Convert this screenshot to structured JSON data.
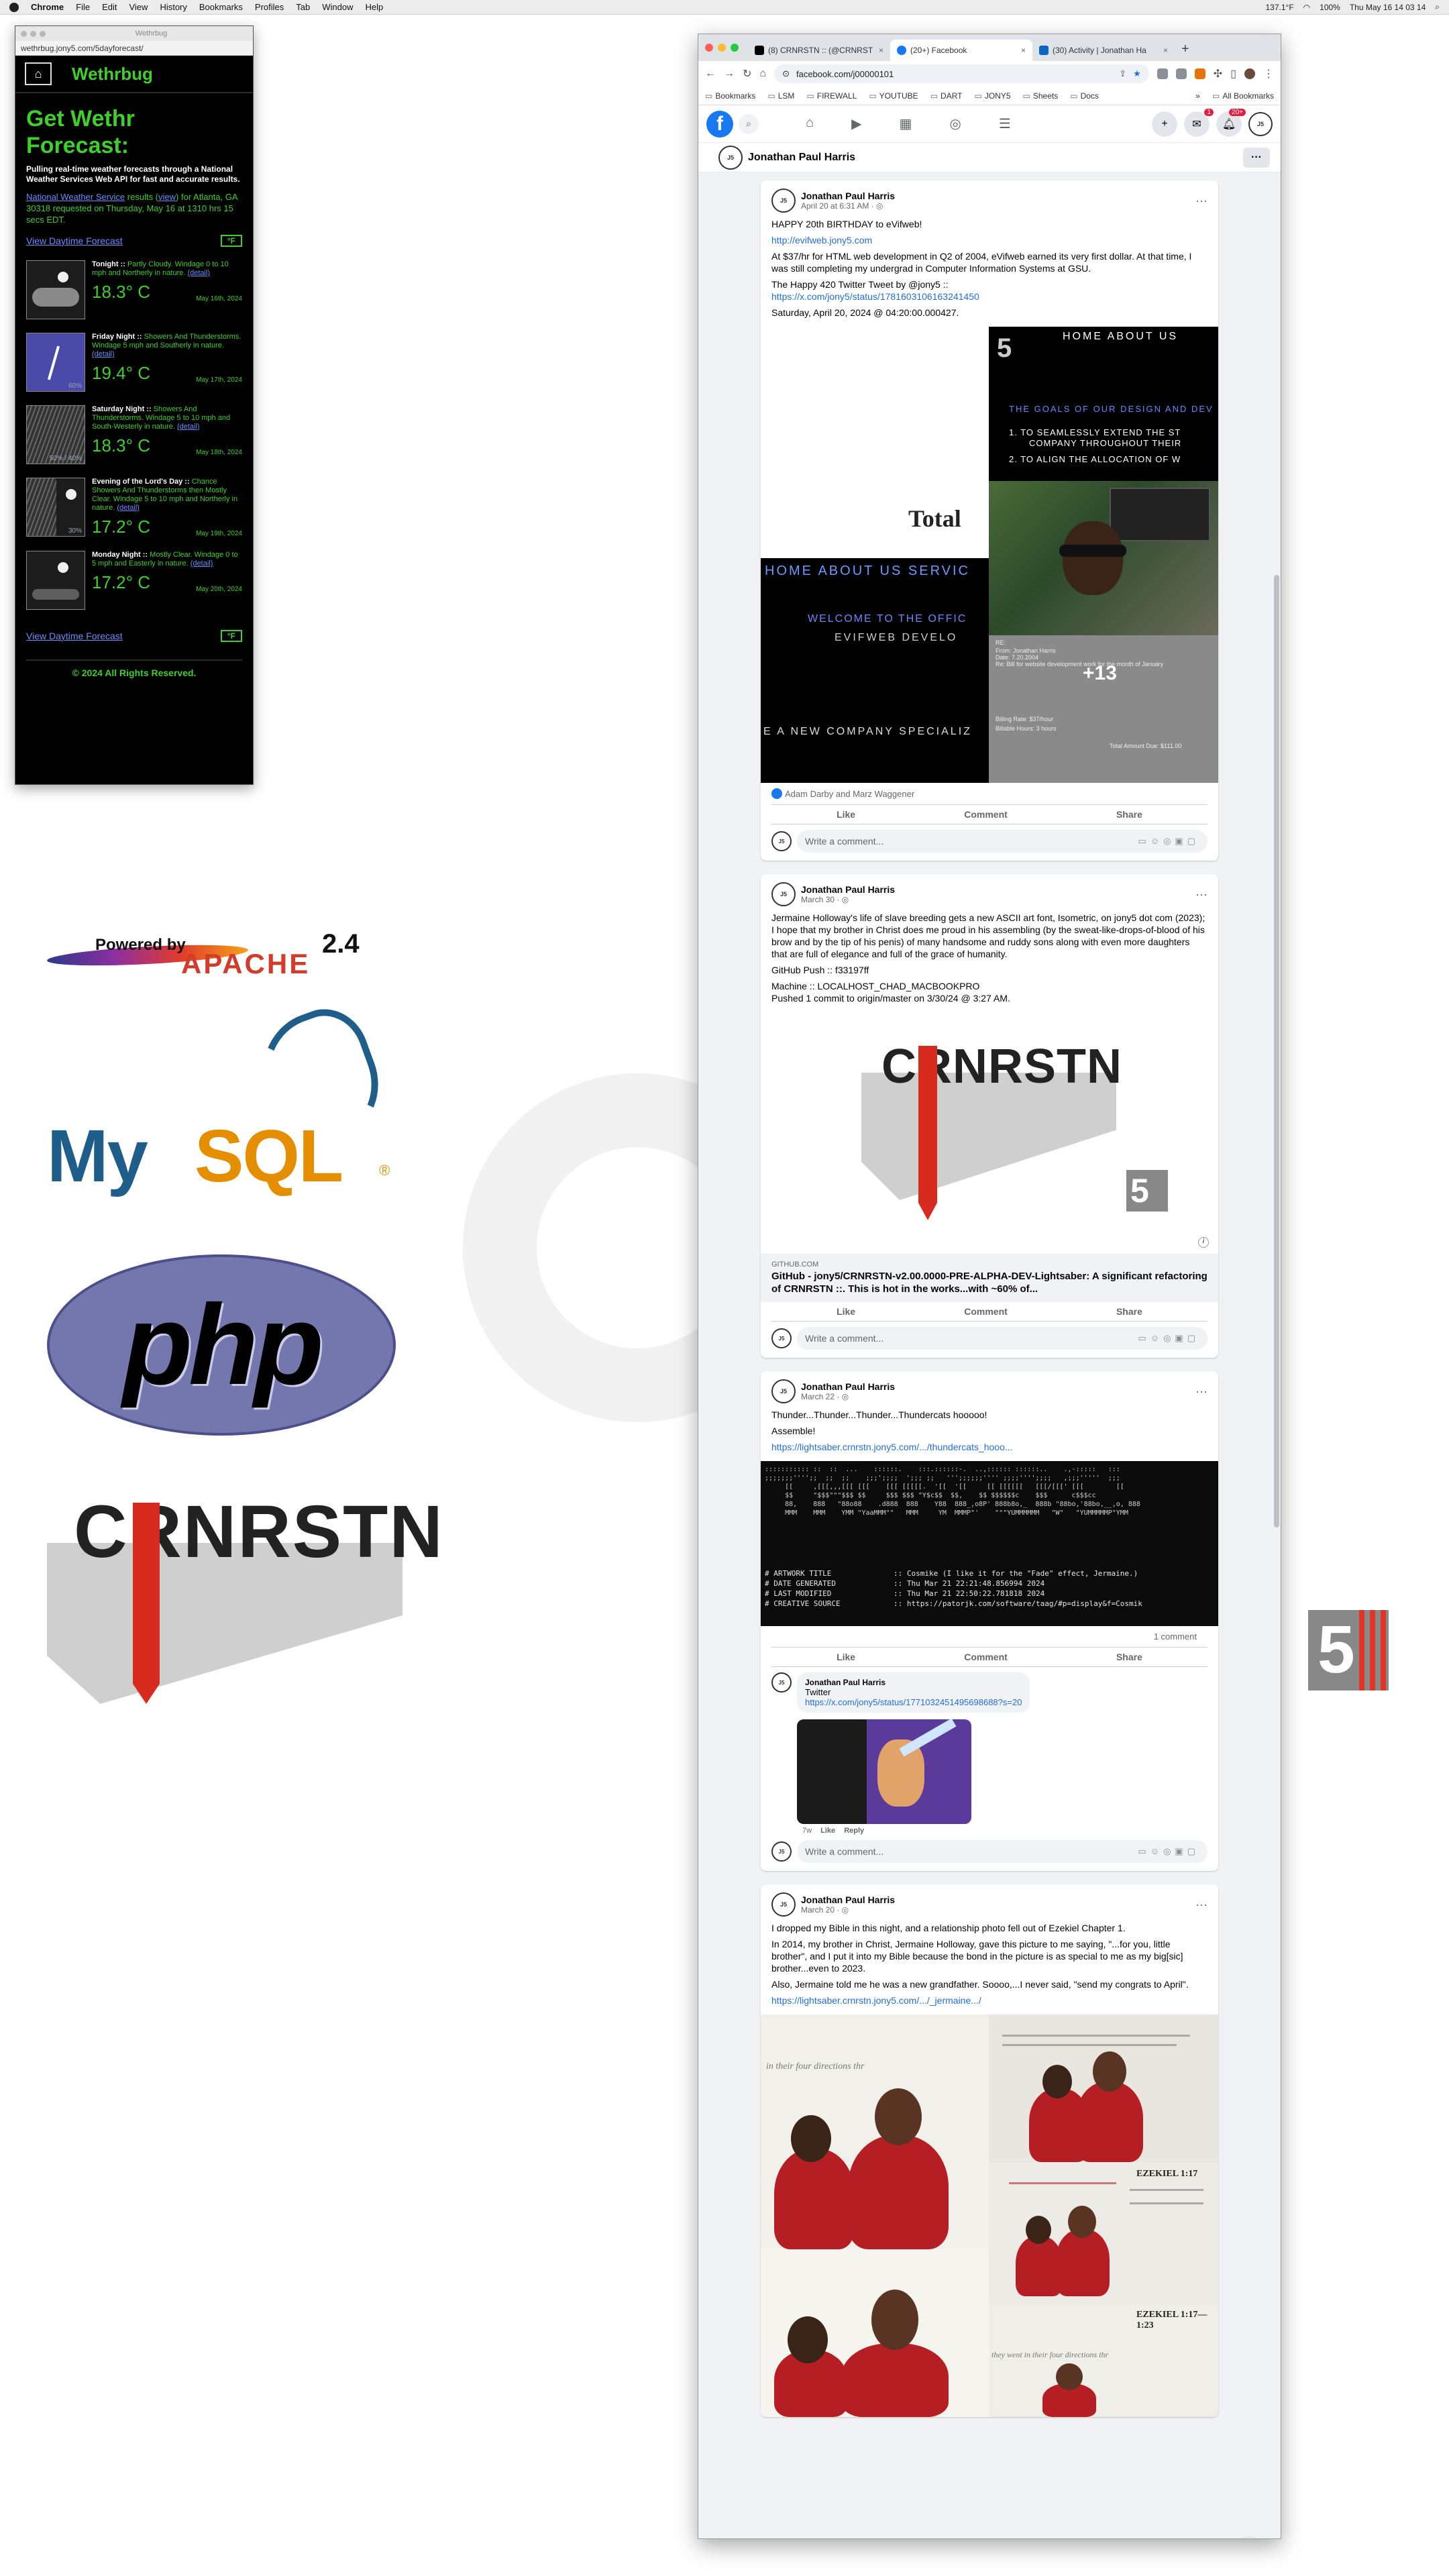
{
  "menubar": {
    "app": "Chrome",
    "items": [
      "File",
      "Edit",
      "View",
      "History",
      "Bookmarks",
      "Profiles",
      "Tab",
      "Window",
      "Help"
    ],
    "battery": "100%",
    "clock": "Thu May 16  14 03 14",
    "temp": "137.1°F"
  },
  "weather": {
    "window_title": "Wethrbug",
    "url": "wethrbug.jony5.com/5dayforecast/",
    "brand": "Wethrbug",
    "heading": "Get Wethr Forecast:",
    "intro": "Pulling real-time weather forecasts through a National Weather Services Web API for fast and accurate results.",
    "source_link": "National Weather Service",
    "source_mid": " results (",
    "view_link": "view",
    "source_tail": ") for Atlanta, GA 30318 requested on Thursday, May 16 at 1310 hrs 15 secs EDT.",
    "daytime_link": "View Daytime Forecast",
    "unit_toggle": "°F",
    "days": [
      {
        "name": "Tonight ::",
        "desc": " Partly Cloudy. Windage 0 to 10 mph and Northerly in nature. ",
        "temp": "18.3° C",
        "date": "May 16th, 2024",
        "icon": "partly-cloudy-night"
      },
      {
        "name": "Friday Night ::",
        "desc": " Showers And Thunderstorms. Windage 5 mph and Southerly in nature. ",
        "temp": "19.4° C",
        "date": "May 17th, 2024",
        "icon": "thunderstorm",
        "pct": "60%"
      },
      {
        "name": "Saturday Night ::",
        "desc": " Showers And Thunderstorms. Windage 5 to 10 mph and South-Westerly in nature. ",
        "temp": "18.3° C",
        "date": "May 18th, 2024",
        "icon": "showers",
        "pct": "50% / 40%"
      },
      {
        "name": "Evening of the Lord's Day ::",
        "desc": " Chance Showers And Thunderstorms then Mostly Clear. Windage 5 to 10 mph and Northerly in nature. ",
        "temp": "17.2° C",
        "date": "May 19th, 2024",
        "icon": "showers-then-clear",
        "pct": "30%"
      },
      {
        "name": "Monday Night ::",
        "desc": " Mostly Clear. Windage 0 to 5 mph and Easterly in nature. ",
        "temp": "17.2° C",
        "date": "May 20th, 2024",
        "icon": "clear-night"
      }
    ],
    "detail_label": "(detail)",
    "footer": "© 2024 All Rights Reserved."
  },
  "logos": {
    "apache_powered": "Powered by",
    "apache_word": "APACHE",
    "apache_version": "2.4",
    "mysql_my": "My",
    "mysql_sql": "SQL",
    "mysql_reg": "®",
    "php": "php",
    "crnrstn": "CRNRSTN",
    "five": "5"
  },
  "browser": {
    "tabs": [
      {
        "label": "(8) CRNRSTN :: (@CRNRST",
        "icon_color": "#000000"
      },
      {
        "label": "(20+) Facebook",
        "icon_color": "#1877f2",
        "active": true
      },
      {
        "label": "(30) Activity | Jonathan Ha",
        "icon_color": "#0a66c2"
      }
    ],
    "url": "facebook.com/j00000101",
    "bookmarks": [
      "Bookmarks",
      "LSM",
      "FIREWALL",
      "YOUTUBE",
      "DART",
      "JONY5",
      "Sheets",
      "Docs"
    ],
    "all_bookmarks": "All Bookmarks"
  },
  "facebook": {
    "logo": "f",
    "notif_badge": "20+",
    "messenger_badge": "1",
    "profile_name": "Jonathan Paul Harris",
    "avatar_text": "J5",
    "write_placeholder": "Write a comment...",
    "actions": {
      "like": "Like",
      "comment": "Comment",
      "share": "Share"
    },
    "posts": [
      {
        "author": "Jonathan Paul Harris",
        "date": "April 20 at 6:31 AM · ◎",
        "paragraphs": [
          "HAPPY 20th BIRTHDAY to eVifweb!",
          "http://evifweb.jony5.com",
          "At $37/hr for HTML web development in Q2 of 2004, eVifweb earned its very first dollar. At that time, I was still completing my undergrad in Computer Information Systems at GSU.",
          "The Happy 420 Twitter Tweet by @jony5 ::",
          "https://x.com/jony5/status/1781603106163241450",
          "Saturday, April 20, 2024 @ 04:20:00.000427."
        ],
        "media": {
          "total": "Total",
          "nav_left": "HOME   ABOUT US   SERVIC",
          "welcome": "WELCOME TO THE OFFIC",
          "evif": "EVIFWEB DEVELO",
          "company": "E A NEW COMPANY SPECIALIZ",
          "nav_right": "HOME   ABOUT US",
          "five": "5",
          "goals": "THE GOALS OF OUR DESIGN AND DEV",
          "goal1": "1.  TO SEAMLESSLY EXTEND THE ST",
          "goal1b": "COMPANY THROUGHOUT THEIR",
          "goal2": "2.  TO ALIGN THE ALLOCATION OF W",
          "more": "+13",
          "doc_lines": [
            "RE:",
            "From:   Jonathan Harris",
            "Date:   7.20.2004",
            "Re:   Bill for website development work for the month of January"
          ],
          "billing": [
            "Billing Rate:   $37/hour",
            "Billable Hours:   3 hours",
            "Total Amount Due:   $111.00"
          ]
        },
        "reactions": "Adam Darby and Marz Waggener"
      },
      {
        "author": "Jonathan Paul Harris",
        "date": "March 30 · ◎",
        "paragraphs": [
          "Jermaine Holloway's life of slave breeding gets a new ASCII art font, Isometric, on jony5 dot com (2023); I hope that my brother in Christ does me proud in his assembling (by the sweat-like-drops-of-blood of his brow and by the tip of his penis) of many handsome and ruddy sons along with even more daughters that are full of elegance and full of the grace of humanity.",
          "GitHub Push :: f33197ff",
          "Machine :: LOCALHOST_CHAD_MACBOOKPRO\nPushed 1 commit to origin/master on 3/30/24 @ 3:27 AM."
        ],
        "card_domain": "GITHUB.COM",
        "card_title": "GitHub - jony5/CRNRSTN-v2.00.0000-PRE-ALPHA-DEV-Lightsaber: A significant refactoring of CRNRSTN ::. This is hot in the works...with ~60% of..."
      },
      {
        "author": "Jonathan Paul Harris",
        "date": "March 22 · ◎",
        "paragraphs": [
          "Thunder...Thunder...Thunder...Thundercats hooooo!",
          "Assemble!",
          "https://lightsaber.crnrstn.jony5.com/.../thundercats_hooo..."
        ],
        "ascii_art": "::::::::::: ::  ::  ...    ::::::.    :::.::::::-.  ..,:::::: ::::::..    .,-:::::   :::\n;;;;;;;'''';;  ;;  ;;    ;;;';;;;  ';;; ;;   ''';;;;;;'''' ;;;;'''';;;;   ,;;;'''''  ;;;\n     [[     ,[[[,,,[[[ [[[    [[[ [[[[[.  '[[  '[[     [[ [[[[[[   [[[/[[[' [[[        [[\n     $$     \"$$$\"\"\"$$$ $$     $$$ $$$ \"Y$c$$  $$,    $$ $$$$$$c    $$$      c$$$cc\n     88,    888   \"88o88    .d888  888    Y88  888_,o8P' 888b8o,_  888b \"88bo,'88bo,__,o, 888\n     MMM    MMM    YMM \"YaaMMM\"\"   MMM     YM  MMMP\"'    \"\"\"YUMMMMMM   \"W\"   \"YUMMMMMP\"YMM",
        "ascii_meta": "# ARTWORK TITLE              :: Cosmike (I like it for the \"Fade\" effect, Jermaine.)\n# DATE GENERATED             :: Thu Mar 21 22:21:48.856994 2024\n# LAST MODIFIED              :: Thu Mar 21 22:50:22.781818 2024\n# CREATIVE SOURCE            :: https://patorjk.com/software/taag/#p=display&f=Cosmik",
        "comment_count": "1 comment",
        "comment": {
          "author": "Jonathan Paul Harris",
          "text": "Twitter",
          "link": "https://x.com/jony5/status/1771032451495698688?s=20",
          "age": "7w",
          "like": "Like",
          "reply": "Reply"
        }
      },
      {
        "author": "Jonathan Paul Harris",
        "date": "March 20 · ◎",
        "paragraphs": [
          "I dropped my Bible in this night, and a relationship photo fell out of Ezekiel Chapter 1.",
          "In 2014, my brother in Christ, Jermaine Holloway, gave this picture to me saying, \"...for you, little brother\", and I put it into my Bible because the bond in the picture is as special to me as my big[sic] brother...even to 2023.",
          "Also, Jermaine told me he was a new grandfather. Soooo,...I never said, \"send my congrats to April\".",
          "https://lightsaber.crnrstn.jony5.com/.../_jermaine.../"
        ],
        "media": {
          "ezekiel": "EZEKIEL 1:17",
          "ezekiel2": "EZEKIEL 1:17—1:23",
          "caption1": "in their four directions thr",
          "caption2": "they went in their four directions thr"
        }
      }
    ]
  }
}
